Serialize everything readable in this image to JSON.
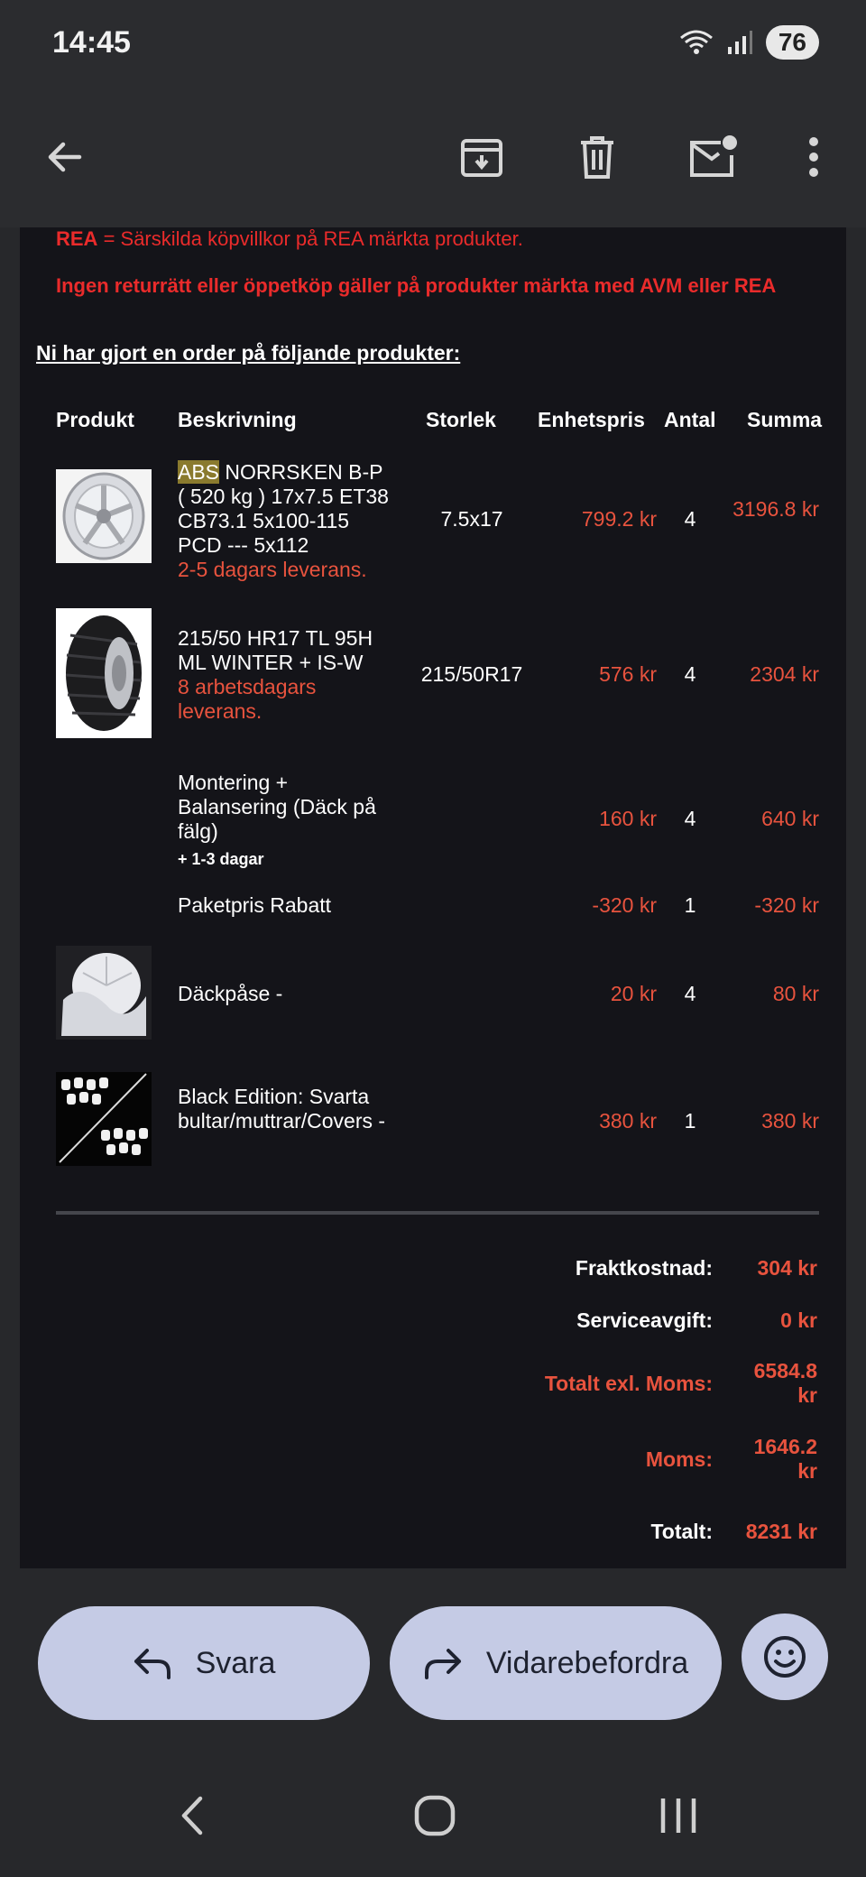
{
  "status": {
    "time": "14:45",
    "battery": "76"
  },
  "notices": {
    "rea_key": "REA",
    "rea_text": " = Särskilda köpvillkor på REA märkta produkter.",
    "no_return": "Ingen returrätt eller öppetköp gäller på produkter märkta med AVM eller REA"
  },
  "heading": "Ni har gjort en order på följande produkter:",
  "columns": {
    "product": "Produkt",
    "description": "Beskrivning",
    "size": "Storlek",
    "unit_price": "Enhetspris",
    "qty": "Antal",
    "sum": "Summa"
  },
  "items": [
    {
      "highlight": "ABS",
      "desc_rest": " NORRSKEN B-P ( 520 kg ) 17x7.5 ET38 CB73.1 5x100-115 PCD --- 5x112",
      "delivery": "2-5 dagars leverans.",
      "size": "7.5x17",
      "unit_price": "799.2 kr",
      "qty": "4",
      "sum": "3196.8 kr"
    },
    {
      "desc": "215/50 HR17 TL 95H ML WINTER + IS-W",
      "delivery": "8 arbetsdagars leverans.",
      "size": "215/50R17",
      "unit_price": "576 kr",
      "qty": "4",
      "sum": "2304 kr"
    },
    {
      "desc": "Montering + Balansering (Däck på fälg)",
      "note": "+ 1-3 dagar",
      "unit_price": "160 kr",
      "qty": "4",
      "sum": "640 kr"
    },
    {
      "desc": "Paketpris Rabatt",
      "unit_price": "-320 kr",
      "qty": "1",
      "sum": "-320 kr"
    },
    {
      "desc": "Däckpåse -",
      "unit_price": "20 kr",
      "qty": "4",
      "sum": "80 kr"
    },
    {
      "desc": "Black Edition: Svarta bultar/muttrar/Covers -",
      "unit_price": "380 kr",
      "qty": "1",
      "sum": "380 kr"
    }
  ],
  "totals": {
    "shipping_label": "Fraktkostnad:",
    "shipping": "304 kr",
    "service_label": "Serviceavgift:",
    "service": "0 kr",
    "excl_vat_label": "Totalt exl. Moms:",
    "excl_vat": "6584.8 kr",
    "vat_label": "Moms:",
    "vat": "1646.2 kr",
    "total_label": "Totalt:",
    "total": "8231 kr"
  },
  "actions": {
    "reply": "Svara",
    "forward": "Vidarebefordra"
  },
  "colors": {
    "accent_red": "#e8533e",
    "pill": "#c5cbe5",
    "background": "#141419"
  },
  "icons": [
    "back-arrow-icon",
    "archive-icon",
    "trash-icon",
    "mark-unread-icon",
    "more-vert-icon",
    "reply-icon",
    "forward-icon",
    "emoji-icon"
  ]
}
